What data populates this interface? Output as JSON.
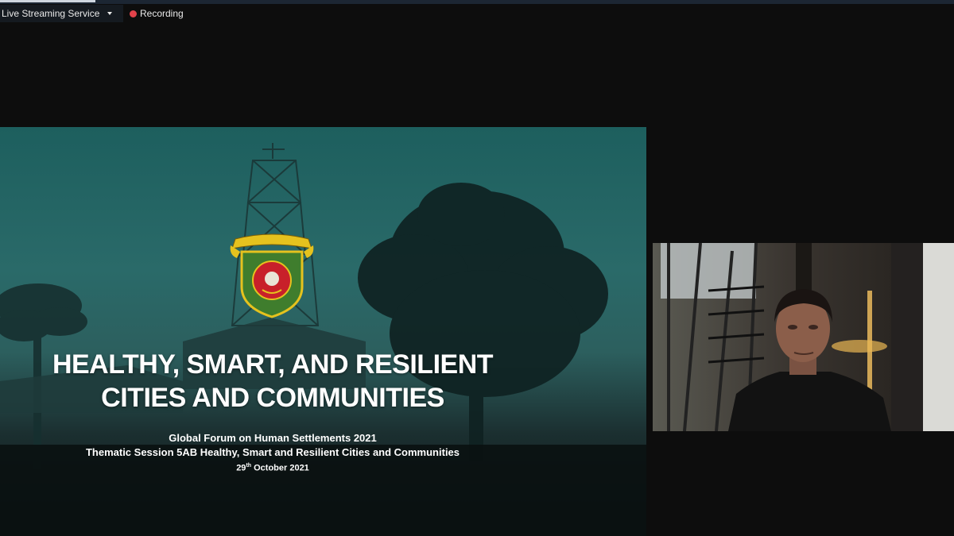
{
  "toolbar": {
    "live_streaming_label": "Live Streaming Service",
    "recording_label": "Recording"
  },
  "slide": {
    "title_line1": "HEALTHY, SMART, AND RESILIENT",
    "title_line2": "CITIES AND COMMUNITIES",
    "subtitle_line1": "Global Forum on Human Settlements 2021",
    "subtitle_line2": "Thematic Session 5AB Healthy, Smart and Resilient Cities and Communities",
    "date_day": "29",
    "date_suffix": "th",
    "date_rest": " October 2021",
    "emblem_text": "KOTA BANJARBARU"
  },
  "colors": {
    "recording_dot": "#e2424a",
    "slide_teal": "#2a6a69"
  }
}
